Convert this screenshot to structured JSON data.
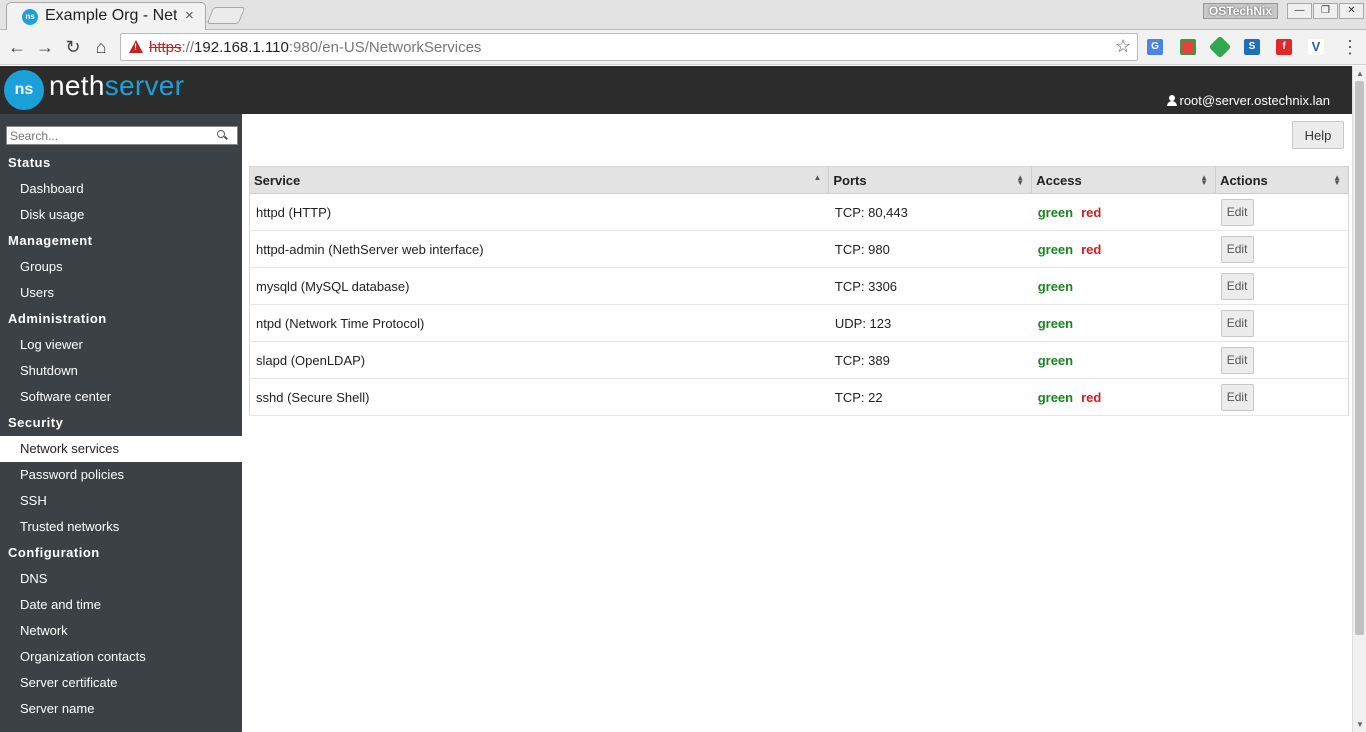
{
  "browser": {
    "tab_title": "Example Org - NethServer",
    "tab_favicon": "ns",
    "tab_close": "×",
    "profile_name": "OSTechNix",
    "url_scheme": "https",
    "url_sep": "://",
    "url_host": "192.168.1.110",
    "url_rest": ":980/en-US/NetworkServices",
    "win_min": "—",
    "win_max": "❐",
    "win_close": "✕"
  },
  "app": {
    "logo_mark": "ns",
    "logo_part1": "neth",
    "logo_part2": "server",
    "user": "root@server.ostechnix.lan",
    "help_label": "Help"
  },
  "sidebar": {
    "search_placeholder": "Search...",
    "groups": [
      {
        "label": "Status",
        "items": [
          "Dashboard",
          "Disk usage"
        ]
      },
      {
        "label": "Management",
        "items": [
          "Groups",
          "Users"
        ]
      },
      {
        "label": "Administration",
        "items": [
          "Log viewer",
          "Shutdown",
          "Software center"
        ]
      },
      {
        "label": "Security",
        "items": [
          "Network services",
          "Password policies",
          "SSH",
          "Trusted networks"
        ]
      },
      {
        "label": "Configuration",
        "items": [
          "DNS",
          "Date and time",
          "Network",
          "Organization contacts",
          "Server certificate",
          "Server name"
        ]
      }
    ]
  },
  "table": {
    "headers": [
      "Service",
      "Ports",
      "Access",
      "Actions"
    ],
    "edit_label": "Edit",
    "rows": [
      {
        "service": "httpd (HTTP)",
        "ports": "TCP: 80,443",
        "green": "green",
        "red": "red"
      },
      {
        "service": "httpd-admin (NethServer web interface)",
        "ports": "TCP: 980",
        "green": "green",
        "red": "red"
      },
      {
        "service": "mysqld (MySQL database)",
        "ports": "TCP: 3306",
        "green": "green",
        "red": ""
      },
      {
        "service": "ntpd (Network Time Protocol)",
        "ports": "UDP: 123",
        "green": "green",
        "red": ""
      },
      {
        "service": "slapd (OpenLDAP)",
        "ports": "TCP: 389",
        "green": "green",
        "red": ""
      },
      {
        "service": "sshd (Secure Shell)",
        "ports": "TCP: 22",
        "green": "green",
        "red": "red"
      }
    ]
  },
  "colors": {
    "brand": "#1aa1d9",
    "header_bg": "#2c2c2c",
    "sidebar_bg": "#3b4144",
    "access_green": "#19861e",
    "access_red": "#d61b1b"
  }
}
